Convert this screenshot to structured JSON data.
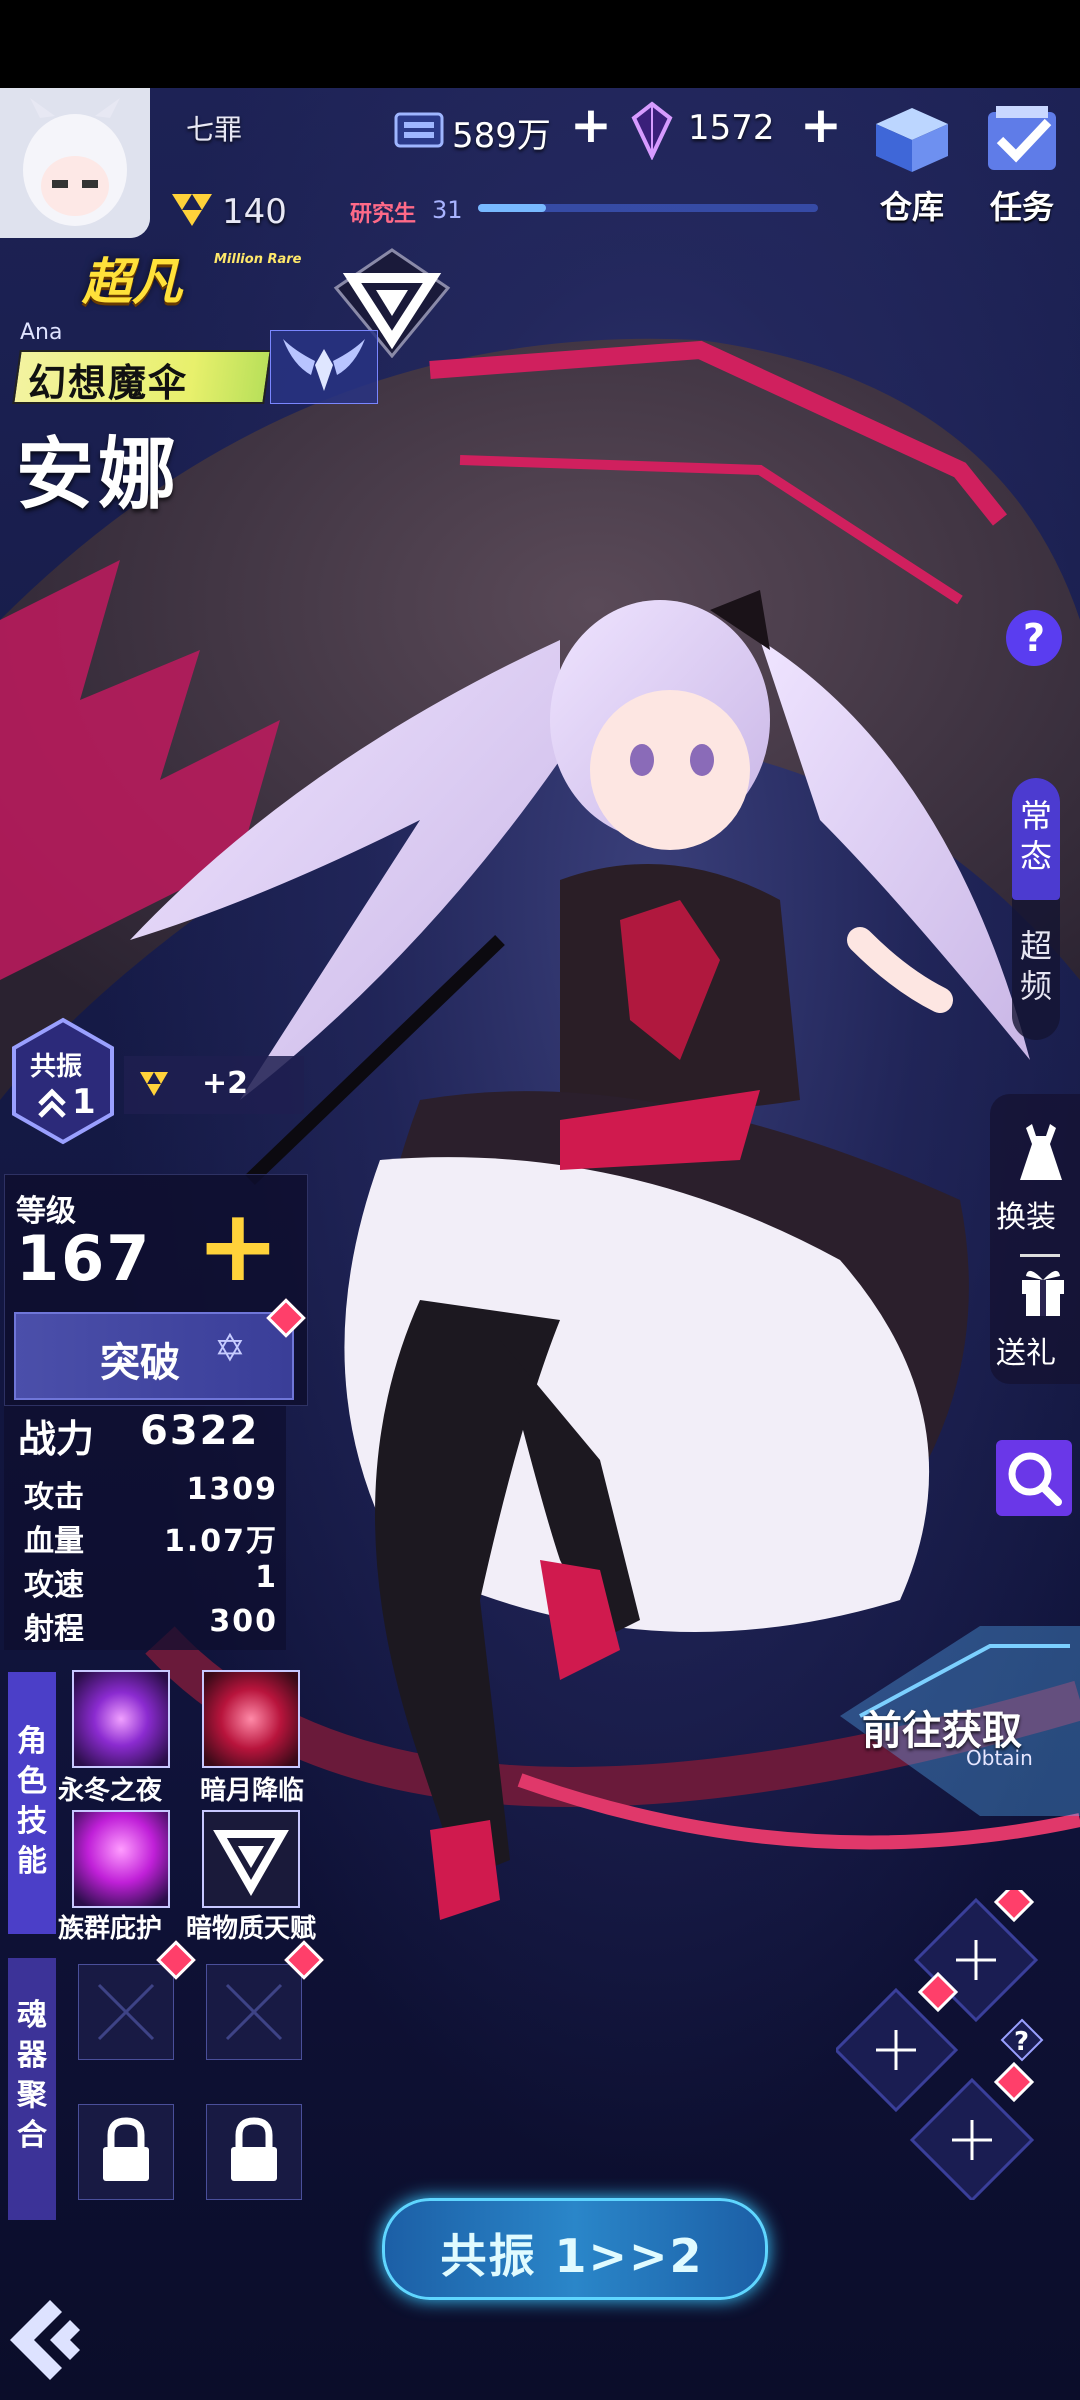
{
  "player": {
    "name": "七罪",
    "level": "140"
  },
  "resources": {
    "coins": "589万",
    "gems": "1572",
    "add_symbol": "+"
  },
  "research": {
    "label": "研究生",
    "level": "31",
    "progress": 0.2
  },
  "top_buttons": {
    "warehouse": "仓库",
    "tasks": "任务"
  },
  "character": {
    "rarity": "超凡",
    "rarity_sub": "Million Rare",
    "name_en": "Ana",
    "title": "幻想魔伞",
    "name_cn": "安娜"
  },
  "help": "?",
  "side_tabs": {
    "normal": [
      "常",
      "态"
    ],
    "super": [
      "超",
      "频"
    ]
  },
  "side_actions": {
    "dress": "换装",
    "gift": "送礼"
  },
  "resonance": {
    "label": "共振",
    "level": "1",
    "bonus": "+2"
  },
  "level": {
    "label": "等级",
    "value": "167",
    "plus": "+"
  },
  "breakthrough": {
    "label": "突破"
  },
  "stats": {
    "power_label": "战力",
    "power_value": "6322",
    "rows": [
      {
        "label": "攻击",
        "value": "1309"
      },
      {
        "label": "血量",
        "value": "1.07万"
      },
      {
        "label": "攻速",
        "value": "1"
      },
      {
        "label": "射程",
        "value": "300"
      }
    ]
  },
  "skills": {
    "section_label": [
      "角",
      "色",
      "技",
      "能"
    ],
    "items": [
      "永冬之夜",
      "暗月降临",
      "族群庇护",
      "暗物质天赋"
    ]
  },
  "soul": {
    "section_label": [
      "魂",
      "器",
      "聚",
      "合"
    ]
  },
  "obtain": {
    "label": "前往获取",
    "sub": "Obtain"
  },
  "resonate_button": {
    "label": "共振 1>>2"
  },
  "colors": {
    "accent": "#4b3fc8",
    "gold": "#ffd23a",
    "alert": "#ff3f6a",
    "cyan": "#5fd6ff"
  }
}
